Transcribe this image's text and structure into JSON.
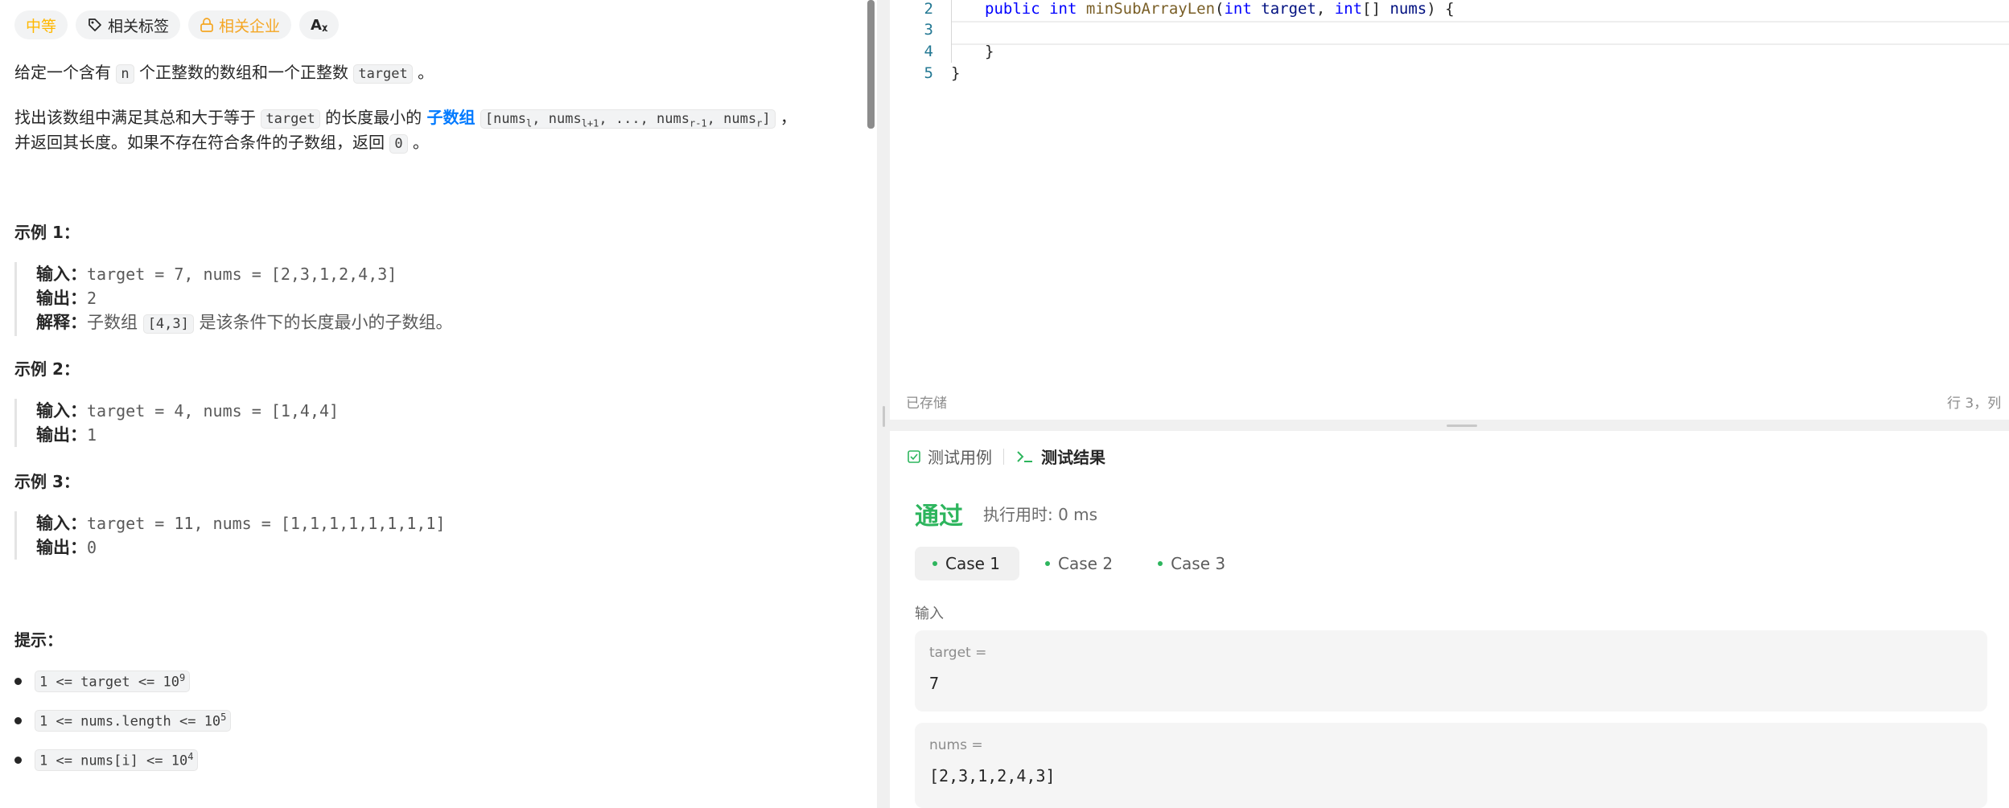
{
  "problem": {
    "tags": {
      "difficulty": "中等",
      "related_tags": "相关标签",
      "related_companies": "相关企业",
      "translate_icon": "translate-icon"
    },
    "desc1_pre": "给定一个含有 ",
    "desc1_n": "n",
    "desc1_mid": " 个正整数的数组和一个正整数 ",
    "desc1_target": "target",
    "desc1_post": " 。",
    "desc2_pre": "找出该数组中满足其总和大于等于 ",
    "desc2_target": "target",
    "desc2_mid": " 的长度最小的 ",
    "desc2_link": "子数组",
    "desc2_sub_a": "[nums",
    "desc2_sub_l": "l",
    "desc2_sub_b": ", nums",
    "desc2_sub_l1": "l+1",
    "desc2_sub_c": ", ..., nums",
    "desc2_sub_r1": "r-1",
    "desc2_sub_d": ", nums",
    "desc2_sub_r": "r",
    "desc2_sub_e": "]",
    "desc2_post": " ，",
    "desc3_pre": "并返回其长度。如果不存在符合条件的子数组，返回 ",
    "desc3_zero": "0",
    "desc3_post": " 。",
    "examples": [
      {
        "title": "示例 1：",
        "input_label": "输入：",
        "input_value": "target = 7, nums = [2,3,1,2,4,3]",
        "output_label": "输出：",
        "output_value": "2",
        "explain_label": "解释：",
        "explain_pre": "子数组 ",
        "explain_code": "[4,3]",
        "explain_post": " 是该条件下的长度最小的子数组。"
      },
      {
        "title": "示例 2：",
        "input_label": "输入：",
        "input_value": "target = 4, nums = [1,4,4]",
        "output_label": "输出：",
        "output_value": "1"
      },
      {
        "title": "示例 3：",
        "input_label": "输入：",
        "input_value": "target = 11, nums = [1,1,1,1,1,1,1,1]",
        "output_label": "输出：",
        "output_value": "0"
      }
    ],
    "hints_title": "提示：",
    "hints": [
      {
        "code": "1 <= target <= 10",
        "sup": "9"
      },
      {
        "code": "1 <= nums.length <= 10",
        "sup": "5"
      },
      {
        "code": "1 <= nums[i] <= 10",
        "sup": "4"
      }
    ]
  },
  "editor": {
    "line_numbers": [
      "2",
      "3",
      "4",
      "5"
    ],
    "line2_public": "public",
    "line2_int": "int",
    "line2_fn": "minSubArrayLen",
    "line2_open": "(",
    "line2_int2": "int",
    "line2_target": "target",
    "line2_comma": ", ",
    "line2_int3": "int",
    "line2_arr": "[] ",
    "line2_nums": "nums",
    "line2_close": ") {",
    "line4": "}",
    "line5": "}",
    "status_saved": "已存储",
    "status_position": "行 3，列"
  },
  "console": {
    "tabs": [
      {
        "label": "测试用例",
        "icon": "checkbox-icon"
      },
      {
        "label": "测试结果",
        "icon": "terminal-icon"
      }
    ],
    "result": "通过",
    "runtime": "执行用时: 0 ms",
    "cases": [
      "Case 1",
      "Case 2",
      "Case 3"
    ],
    "input_label": "输入",
    "fields": [
      {
        "name": "target =",
        "value": "7"
      },
      {
        "name": "nums =",
        "value": "[2,3,1,2,4,3]"
      }
    ]
  },
  "colors": {
    "accent_green": "#2db55d",
    "link_blue": "#007aff",
    "difficulty": "#ffb800"
  }
}
